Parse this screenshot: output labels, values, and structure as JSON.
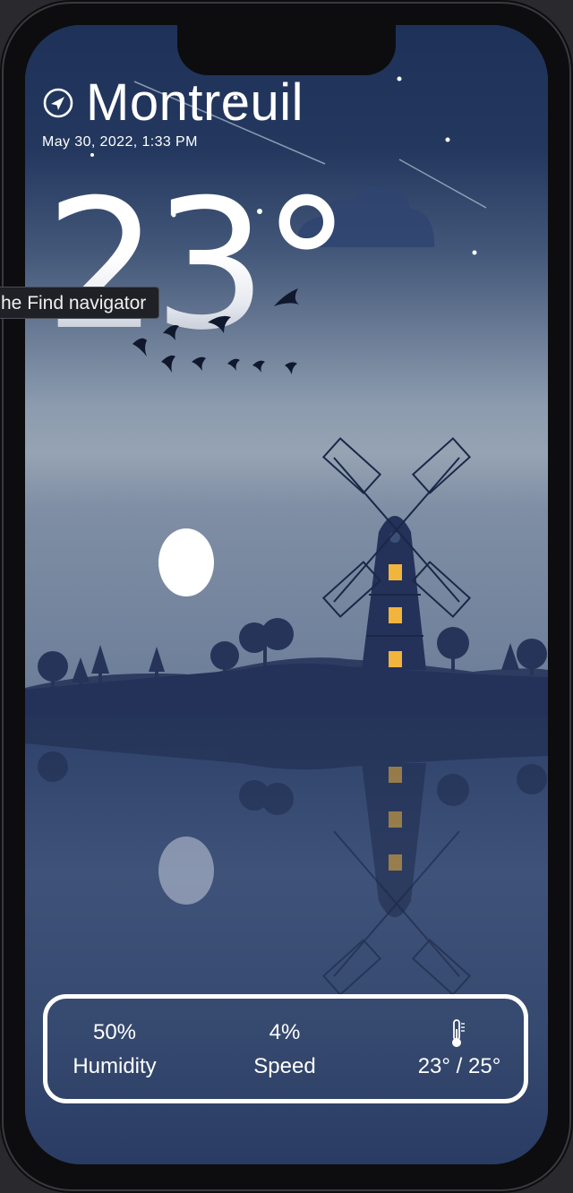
{
  "location": {
    "city": "Montreuil",
    "datetime": "May 30, 2022, 1:33 PM",
    "icon": "location-arrow-icon"
  },
  "weather": {
    "temperature": "23°"
  },
  "tooltip": {
    "text": "he Find navigator"
  },
  "stats": {
    "humidity_value": "50%",
    "humidity_label": "Humidity",
    "speed_value": "4%",
    "speed_label": "Speed",
    "temp_range": "23° /  25°",
    "thermometer_icon": "thermometer-icon"
  },
  "colors": {
    "sky_top": "#1e3259",
    "sky_horizon": "#8e9db0",
    "ground": "#26345a",
    "water": "#2d416a",
    "window_light": "#f1b43d"
  }
}
